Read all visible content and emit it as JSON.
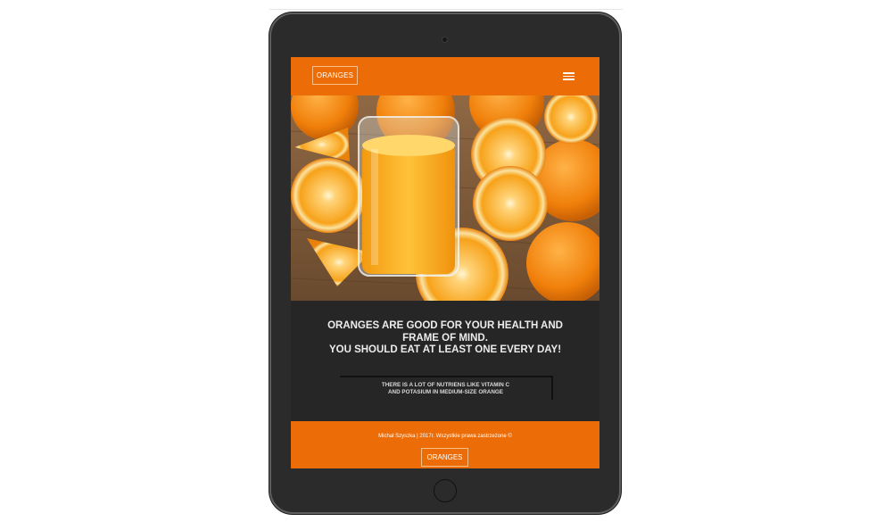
{
  "header": {
    "logo_text": "ORANGES",
    "menu_icon": "hamburger-menu-icon"
  },
  "hero": {
    "image_icon": "orange-juice-photo"
  },
  "content": {
    "headline_line1": "ORANGES ARE GOOD FOR YOUR HEALTH AND",
    "headline_line2": "FRAME OF MIND.",
    "headline_line3": "YOU SHOULD EAT AT LEAST ONE EVERY DAY!",
    "info_line1": "THERE IS A LOT OF NUTRIENS LIKE VITAMIN C",
    "info_line2": "AND POTASIUM IN MEDIUM-SIZE ORANGE"
  },
  "footer": {
    "copyright": "Michał Szyszka | 2017r. Wszystkie prawa zastrzeżone ©",
    "logo_text": "ORANGES"
  },
  "colors": {
    "accent": "#ec6d08",
    "screen_bg": "#262626",
    "device_body": "#2b2b2b"
  }
}
